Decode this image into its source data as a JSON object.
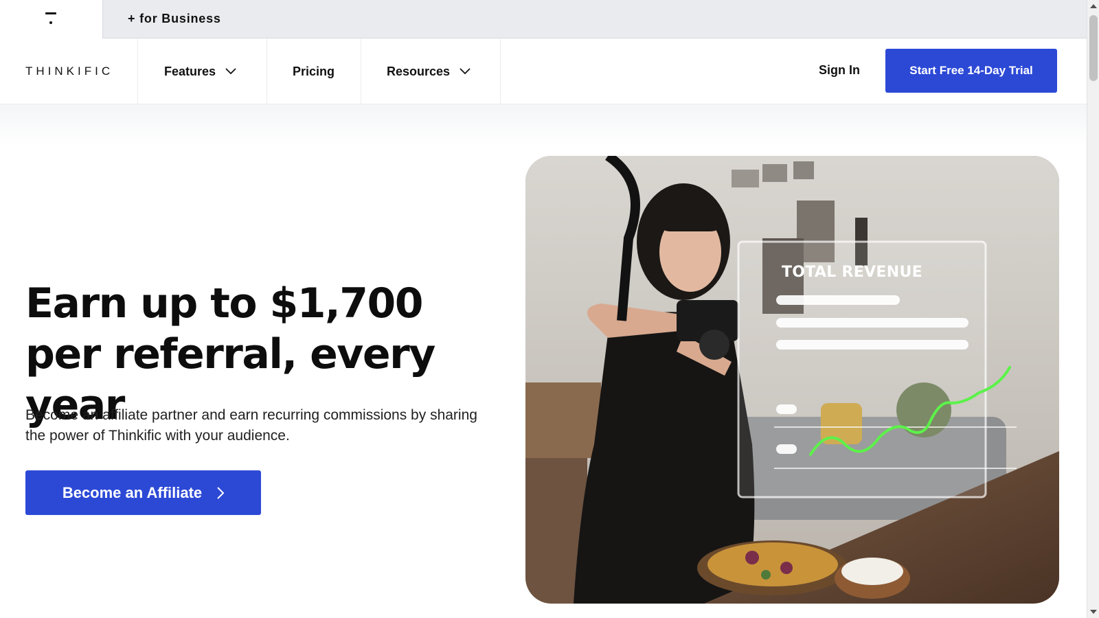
{
  "topbar": {
    "for_business": "+ for Business"
  },
  "nav": {
    "brand": "THINKIFIC",
    "features": "Features",
    "pricing": "Pricing",
    "resources": "Resources",
    "sign_in": "Sign In",
    "trial_cta": "Start Free 14-Day Trial"
  },
  "hero": {
    "title": "Earn up to $1,700 per referral, every year",
    "subtitle": "Become an affiliate partner and earn recurring commissions by sharing the power of Thinkific with your audience.",
    "cta": "Become an Affiliate",
    "image_overlay_label": "TOTAL REVENUE"
  },
  "colors": {
    "accent": "#2c49d6",
    "chart_line": "#5cf24a"
  },
  "icons": [
    "thinkific-logo-icon",
    "chevron-down-icon",
    "chevron-right-icon"
  ]
}
